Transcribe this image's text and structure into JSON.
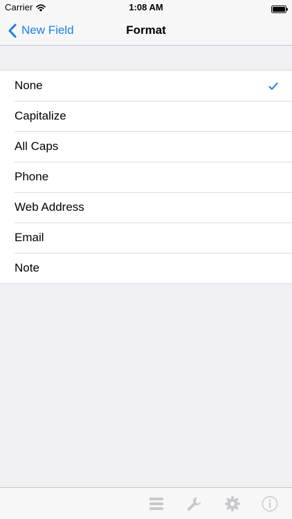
{
  "status_bar": {
    "carrier": "Carrier",
    "time": "1:08 AM",
    "wifi_icon": "wifi-icon",
    "battery_icon": "battery-icon"
  },
  "nav": {
    "back_label": "New Field",
    "title": "Format"
  },
  "format_options": [
    {
      "label": "None",
      "selected": true
    },
    {
      "label": "Capitalize",
      "selected": false
    },
    {
      "label": "All Caps",
      "selected": false
    },
    {
      "label": "Phone",
      "selected": false
    },
    {
      "label": "Web Address",
      "selected": false
    },
    {
      "label": "Email",
      "selected": false
    },
    {
      "label": "Note",
      "selected": false
    }
  ],
  "toolbar": {
    "icons": [
      "list-icon",
      "wrench-icon",
      "gear-icon",
      "info-icon"
    ]
  },
  "colors": {
    "accent": "#1a7fe7",
    "background": "#efeff4",
    "disabled_icon": "#c8c8cc"
  }
}
